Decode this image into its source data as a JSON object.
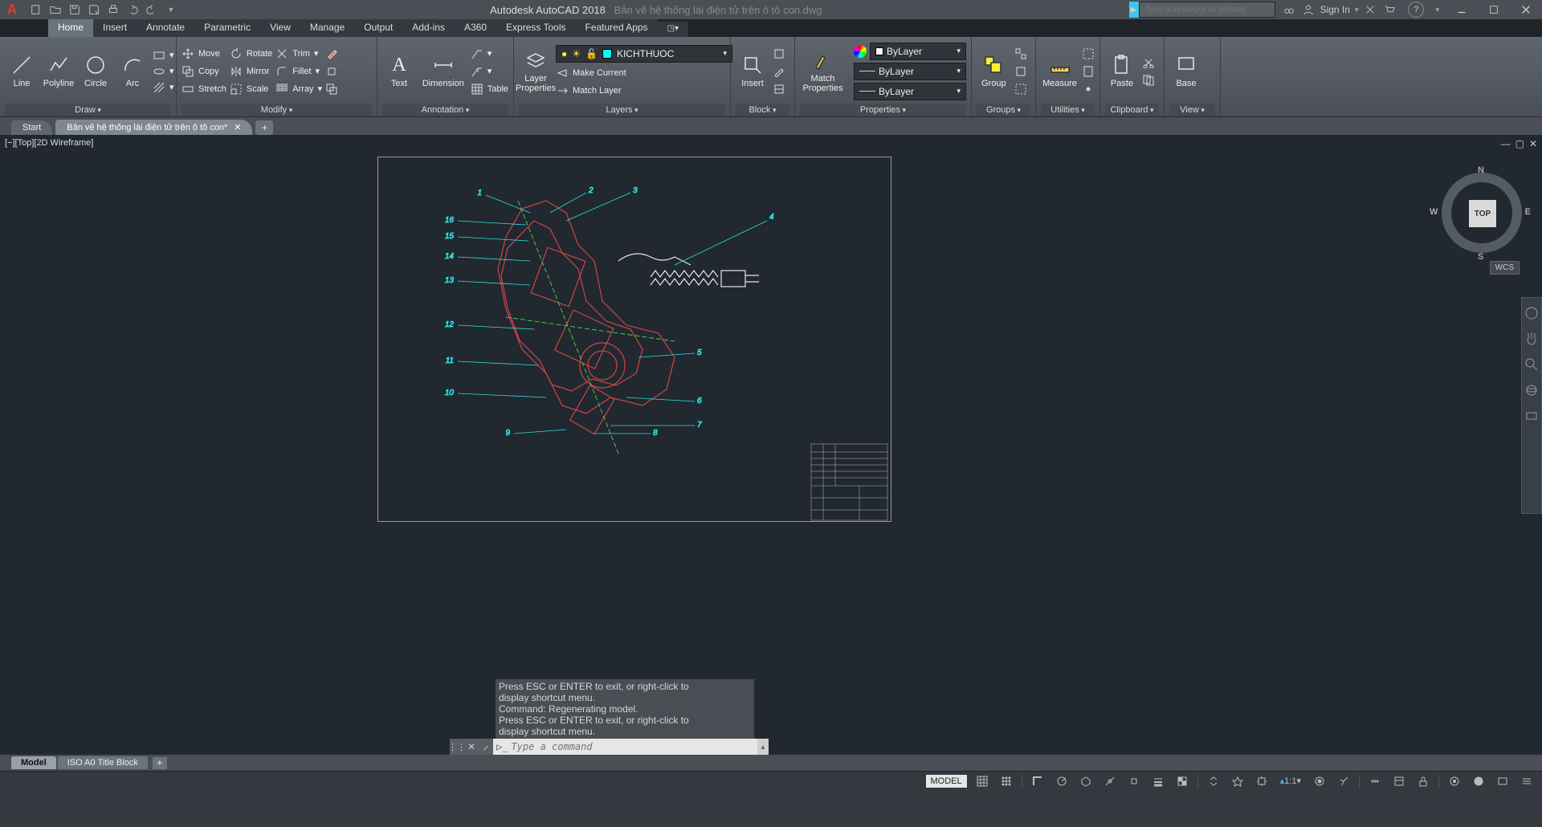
{
  "title": {
    "app": "Autodesk AutoCAD 2018",
    "file": "Bản vẽ hệ thống lái điện tử trên ô tô con.dwg"
  },
  "search": {
    "placeholder": "Type a keyword or phrase"
  },
  "user": {
    "sign_in": "Sign In"
  },
  "menu_tabs": [
    "Home",
    "Insert",
    "Annotate",
    "Parametric",
    "View",
    "Manage",
    "Output",
    "Add-ins",
    "A360",
    "Express Tools",
    "Featured Apps"
  ],
  "menu_active_index": 0,
  "ribbon": {
    "draw": {
      "label": "Draw",
      "line": "Line",
      "polyline": "Polyline",
      "circle": "Circle",
      "arc": "Arc"
    },
    "modify": {
      "label": "Modify",
      "move": "Move",
      "rotate": "Rotate",
      "trim": "Trim",
      "copy": "Copy",
      "mirror": "Mirror",
      "fillet": "Fillet",
      "stretch": "Stretch",
      "scale": "Scale",
      "array": "Array"
    },
    "annotation": {
      "label": "Annotation",
      "text": "Text",
      "dimension": "Dimension",
      "table": "Table"
    },
    "layers": {
      "label": "Layers",
      "layer_properties": "Layer\nProperties",
      "current_layer": "KICHTHUOC",
      "make_current": "Make Current",
      "match_layer": "Match Layer"
    },
    "block": {
      "label": "Block",
      "insert": "Insert"
    },
    "properties": {
      "label": "Properties",
      "match_properties": "Match\nProperties",
      "color": "ByLayer",
      "lineweight": "ByLayer",
      "linetype": "ByLayer"
    },
    "groups": {
      "label": "Groups",
      "group": "Group"
    },
    "utilities": {
      "label": "Utilities",
      "measure": "Measure"
    },
    "clipboard": {
      "label": "Clipboard",
      "paste": "Paste"
    },
    "view": {
      "label": "View",
      "base": "Base"
    }
  },
  "file_tabs": {
    "start": "Start",
    "active": "Bản vẽ hệ thống lái điện tử trên ô tô con*"
  },
  "viewport": {
    "controls": "[−][Top][2D Wireframe]"
  },
  "nav_cube": {
    "face": "TOP",
    "n": "N",
    "e": "E",
    "s": "S",
    "w": "W"
  },
  "wcs": "WCS",
  "cmd_history": {
    "l1": "Press ESC or ENTER to exit, or right-click to",
    "l2": "display shortcut menu.",
    "l3": "Command: Regenerating model.",
    "l4": "Press ESC or ENTER to exit, or right-click to",
    "l5": "display shortcut menu."
  },
  "cmd_prompt": {
    "caret": "▷_",
    "placeholder": "Type a command"
  },
  "layout_tabs": {
    "model": "Model",
    "iso": "ISO A0 Title Block"
  },
  "status": {
    "model": "MODEL",
    "scale": "1:1"
  },
  "drawing_labels": [
    "1",
    "2",
    "3",
    "4",
    "5",
    "6",
    "7",
    "8",
    "9",
    "10",
    "11",
    "12",
    "13",
    "14",
    "15",
    "16"
  ]
}
